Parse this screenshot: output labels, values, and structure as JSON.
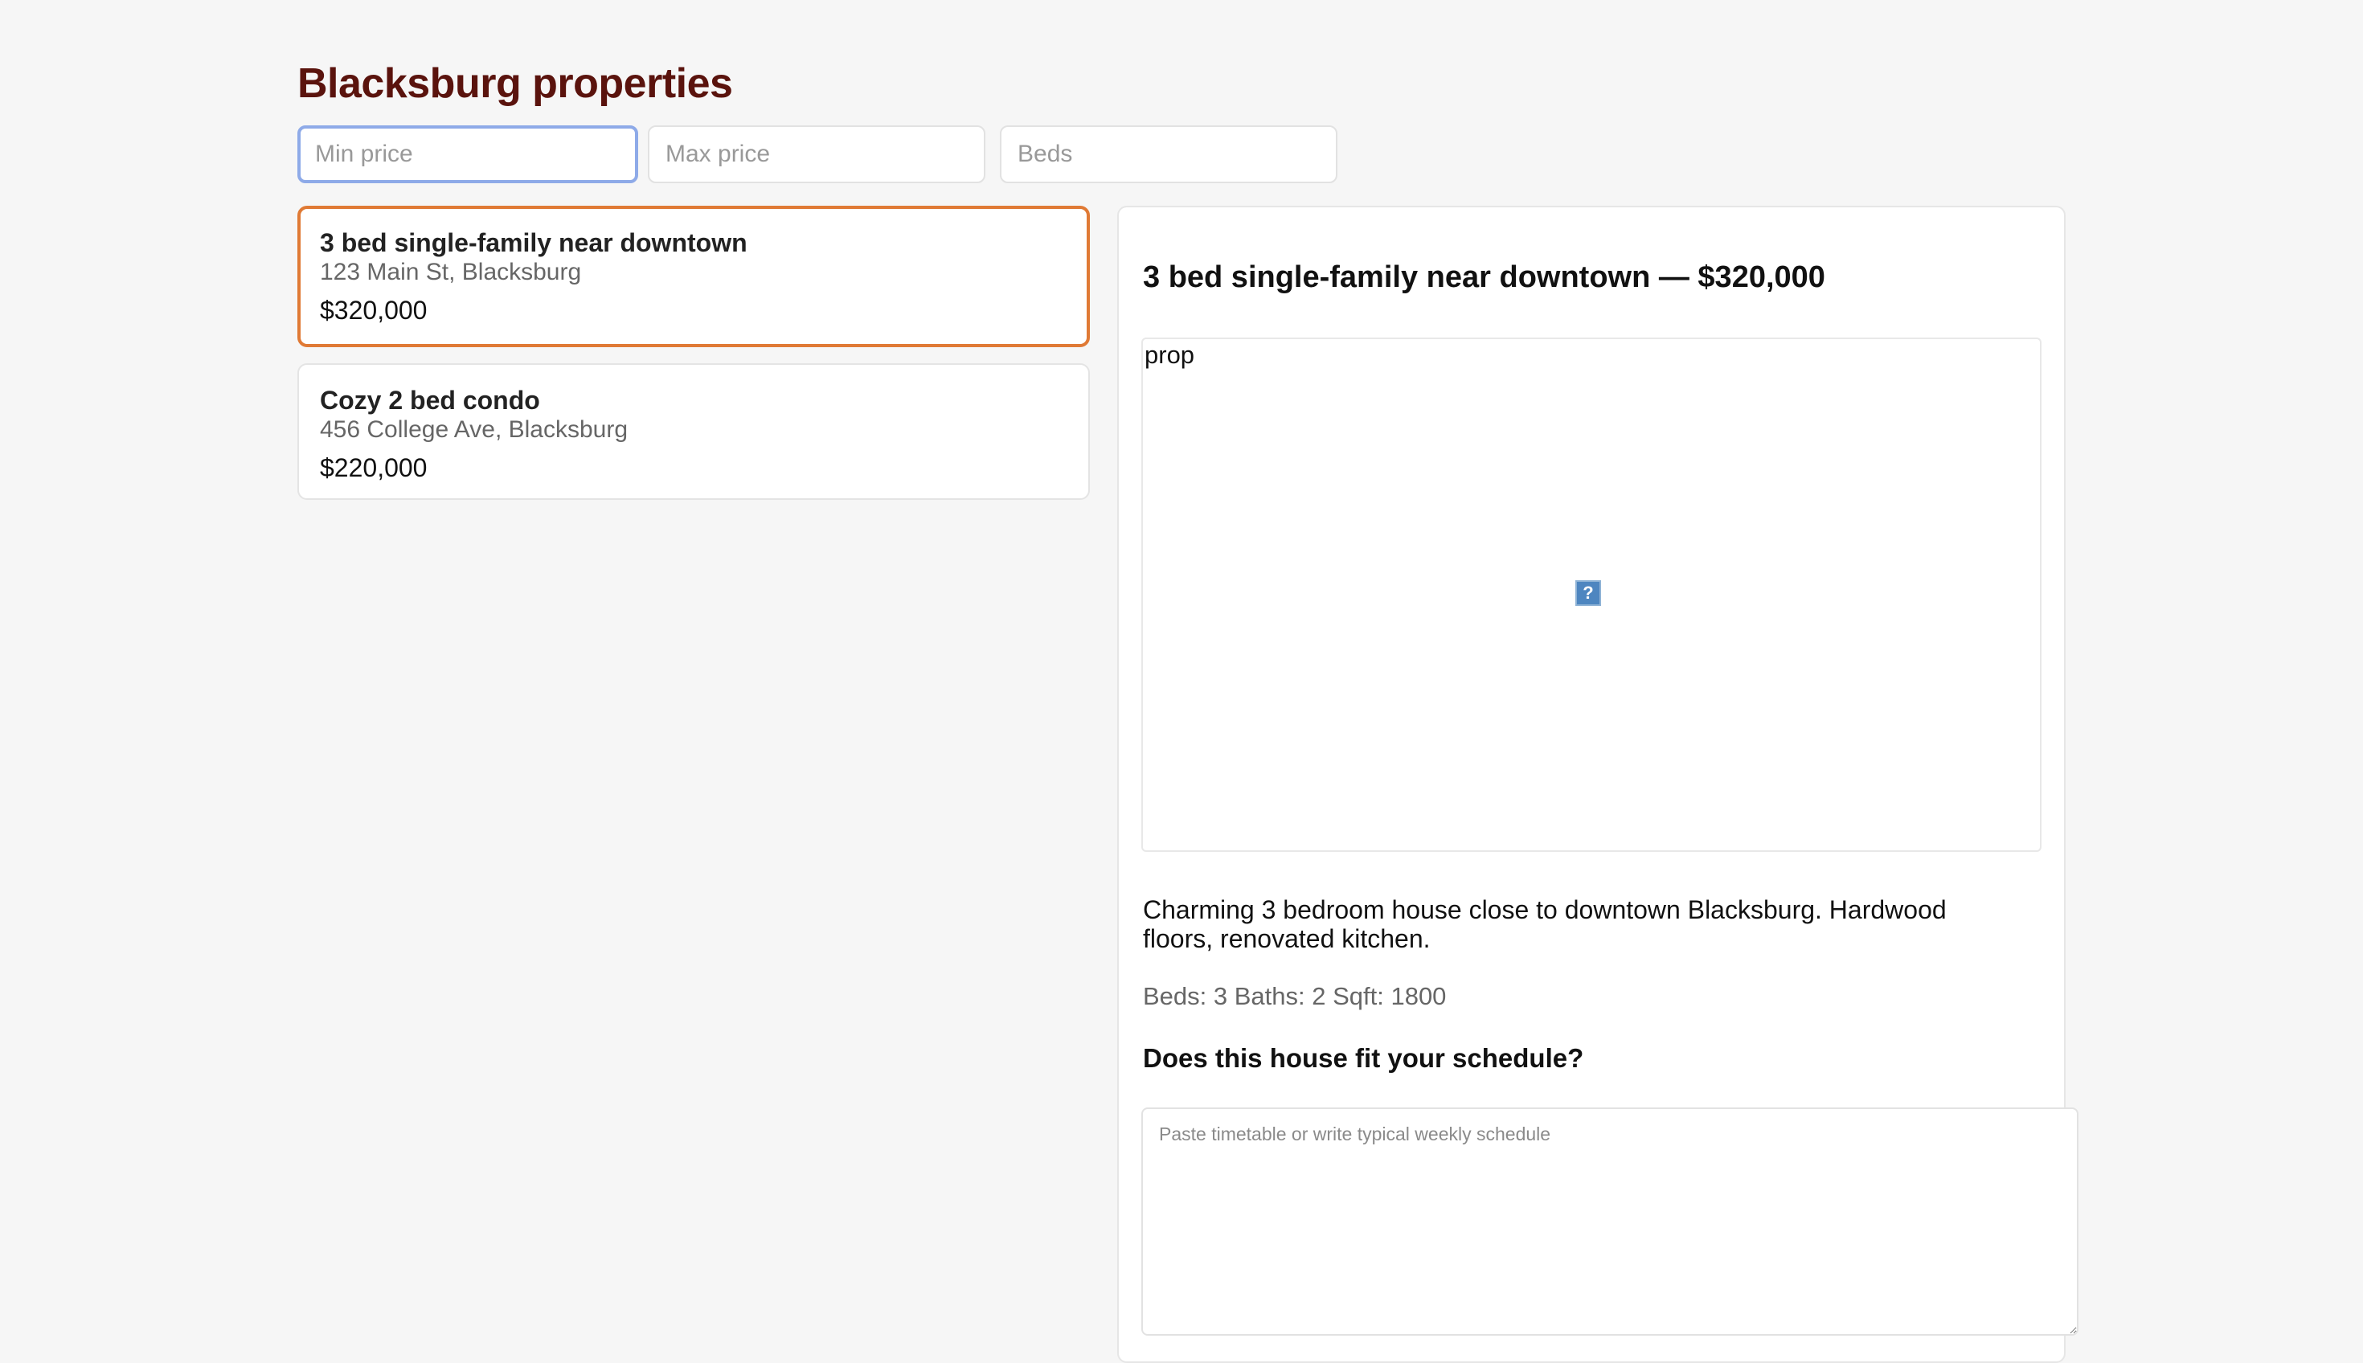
{
  "page": {
    "title": "Blacksburg properties"
  },
  "filters": {
    "min_price_placeholder": "Min price",
    "max_price_placeholder": "Max price",
    "beds_placeholder": "Beds"
  },
  "listings": [
    {
      "title": "3 bed single-family near downtown",
      "address": "123 Main St, Blacksburg",
      "price": "$320,000",
      "selected": true
    },
    {
      "title": "Cozy 2 bed condo",
      "address": "456 College Ave, Blacksburg",
      "price": "$220,000",
      "selected": false
    }
  ],
  "detail": {
    "heading": "3 bed single-family near downtown — $320,000",
    "image_alt": "prop",
    "broken_image_glyph": "?",
    "description": "Charming 3 bedroom house close to downtown Blacksburg. Hardwood floors, renovated kitchen.",
    "specs": "Beds: 3 Baths: 2 Sqft: 1800",
    "schedule_heading": "Does this house fit your schedule?",
    "schedule_placeholder": "Paste timetable or write typical weekly schedule"
  },
  "colors": {
    "title": "#5a130d",
    "selected_border": "#e07a35",
    "focus_border": "#8eaae8"
  }
}
